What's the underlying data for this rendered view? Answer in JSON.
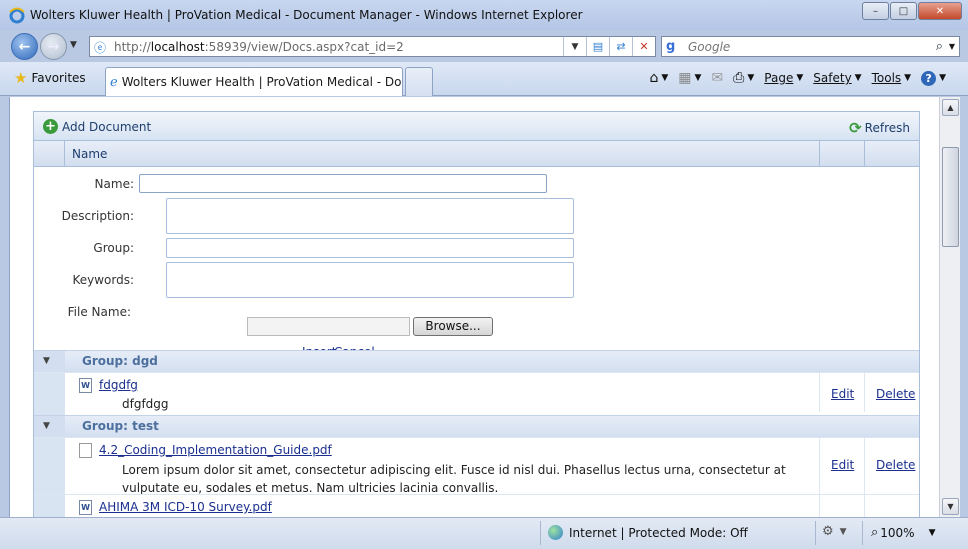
{
  "window": {
    "title": "Wolters Kluwer Health | ProVation Medical - Document Manager - Windows Internet Explorer"
  },
  "address_bar": {
    "url_prefix": "http://",
    "url_host": "localhost",
    "url_rest": ":58939/view/Docs.aspx?cat_id=2",
    "search_placeholder": "Google"
  },
  "favorites": {
    "label": "Favorites"
  },
  "tab": {
    "title": "Wolters Kluwer Health | ProVation Medical - Doc..."
  },
  "commands": {
    "page": "Page",
    "safety": "Safety",
    "tools": "Tools"
  },
  "toolbar": {
    "add_document": "Add Document",
    "refresh": "Refresh"
  },
  "grid_header": {
    "name": "Name"
  },
  "insert_form": {
    "name_label": "Name:",
    "description_label": "Description:",
    "group_label": "Group:",
    "keywords_label": "Keywords:",
    "file_name_label": "File Name:",
    "browse_label": "Browse...",
    "insert_label": "Insert",
    "cancel_label": "Cancel"
  },
  "groups": [
    {
      "title": "Group: dgd",
      "documents": [
        {
          "name": "fdgdfg",
          "description": "dfgfdgg",
          "edit": "Edit",
          "delete": "Delete"
        }
      ]
    },
    {
      "title": "Group: test",
      "documents": [
        {
          "name": "4.2_Coding_Implementation_Guide.pdf",
          "description": "Lorem ipsum dolor sit amet, consectetur adipiscing elit. Fusce id nisl dui. Phasellus lectus urna, consectetur at vulputate eu, sodales et metus. Nam ultricies lacinia convallis.",
          "edit": "Edit",
          "delete": "Delete"
        },
        {
          "name": "AHIMA 3M ICD-10 Survey.pdf"
        }
      ]
    }
  ],
  "status_bar": {
    "zone": "Internet | Protected Mode: Off",
    "zoom": "100%"
  }
}
